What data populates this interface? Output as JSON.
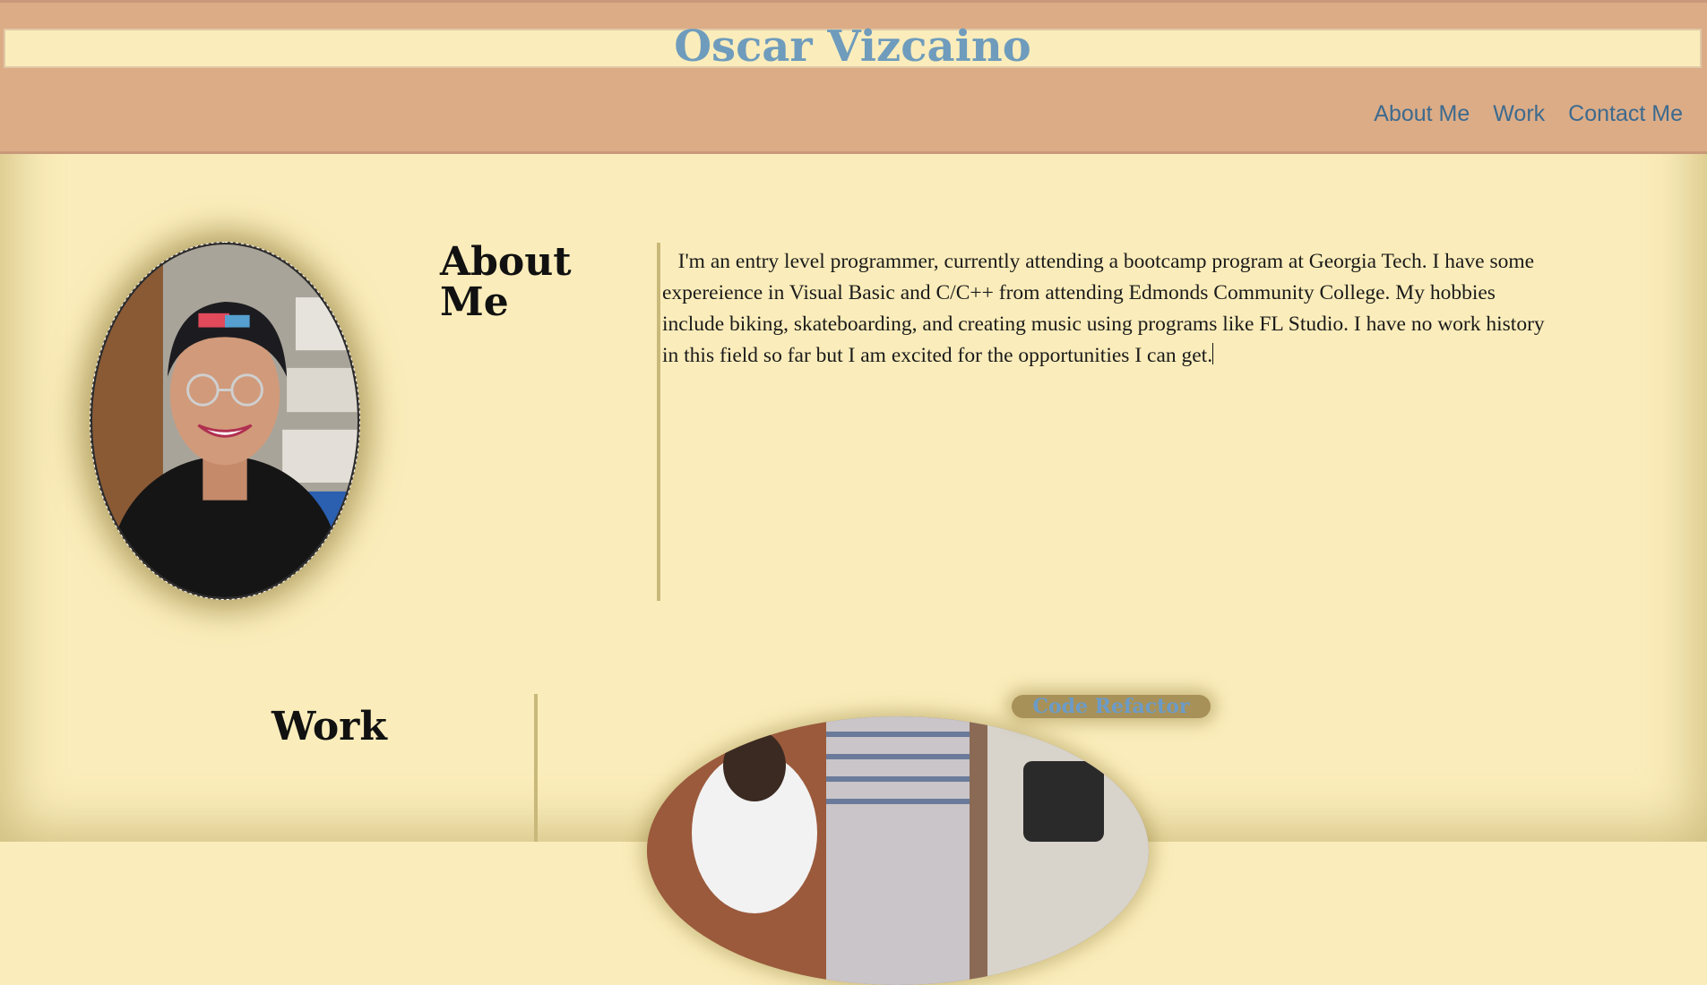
{
  "header": {
    "site_title": "Oscar Vizcaino",
    "nav": [
      "About Me",
      "Work",
      "Contact Me"
    ]
  },
  "about": {
    "heading": "About Me",
    "body": "I'm an entry level programmer, currently attending a bootcamp program at Georgia Tech. I have some expereience in Visual Basic and C/C++ from attending Edmonds Community College. My hobbies include biking, skateboarding, and creating music using programs like FL Studio. I have no work history in this field so far but I am excited for the opportunities I can get.",
    "photo_icon": "profile-photo"
  },
  "work": {
    "heading": "Work",
    "project_label": "Code Refactor",
    "image_icon": "project-thumbnail"
  },
  "colors": {
    "page_bg": "#fbedbb",
    "header_bg": "#dcac86",
    "title_color": "#6f9cbc",
    "nav_color": "#3d6a8e",
    "divider": "#c8b87a",
    "label_bg": "#a89158"
  }
}
